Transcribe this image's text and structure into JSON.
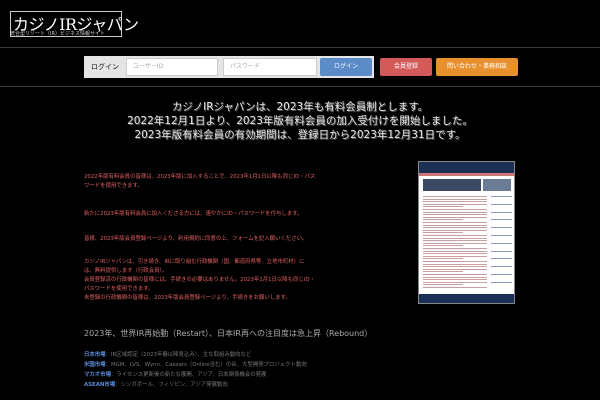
{
  "header": {
    "logo_title": "カジノIRジャパン",
    "logo_subtitle": "統合型リゾート（IR）ビジネス情報サイト"
  },
  "login": {
    "label": "ログイン",
    "user_placeholder": "ユーザーID",
    "password_placeholder": "パスワード",
    "submit_label": "ログイン",
    "register_label": "会員登録",
    "contact_label": "問い合わせ・業務相談"
  },
  "announcement": {
    "line1": "カジノIRジャパンは、2023年も有料会員制とします。",
    "line2": "2022年12月1日より、2023年版有料会員の加入受付けを開始しました。",
    "line3": "2023年版有料会員の有効期間は、登録日から2023年12月31日です。"
  },
  "body": {
    "p1": "2022年版有料会員の皆様は、2023年版に加入することで、2023年1月1日以降も同じID・パス",
    "p2": "ワードを使用できます。",
    "p3": "新たに2023年版有料会員に加入くださる方には、速やかにID・パスワードを付与します。",
    "p4": "皆様、2023年版会員登録ページより、利用規約に同意の上、フォームを記入願いください。",
    "p5": "カジノIRジャパンは、引き続き、IRに取り組む行政機関（国、都道府県等、立地市町村）に",
    "p6": "は、無料提供します（行政会員）。",
    "p7": "会員登録済の行政機関の皆様には、手続きの必要はありません。2023年1月1日以降も同じID・",
    "p8": "パスワードを使用できます。",
    "p9": "未登録の行政機関の皆様は、2023年版会員登録ページより、手続きをお願いします。"
  },
  "section": {
    "heading": "2023年、世界IR再始動（Restart）、日本IR再への注目度は急上昇（Rebound）"
  },
  "list": [
    {
      "key": "日本市場",
      "text": "：IR区域認定（2023年春以降見込み）、主な取組み動向など"
    },
    {
      "key": "米国市場",
      "text": "：MGM、LVS、Wynn、Caesars（Online含む）の合、大型開発プロジェクト動向"
    },
    {
      "key": "マカオ市場",
      "text": "：ライセンス更新後の新たな展開、アジア、日本関係機会の発展"
    },
    {
      "key": "ASEAN市場",
      "text": "：シンガポール、フィリピン、アジア発展動向"
    }
  ],
  "colors": {
    "background": "#000000",
    "body_text": "#e06060",
    "list_key": "#5a8ad8",
    "login_button": "#5b8cc7",
    "register_button": "#d45a5a",
    "contact_button": "#e8902e"
  }
}
